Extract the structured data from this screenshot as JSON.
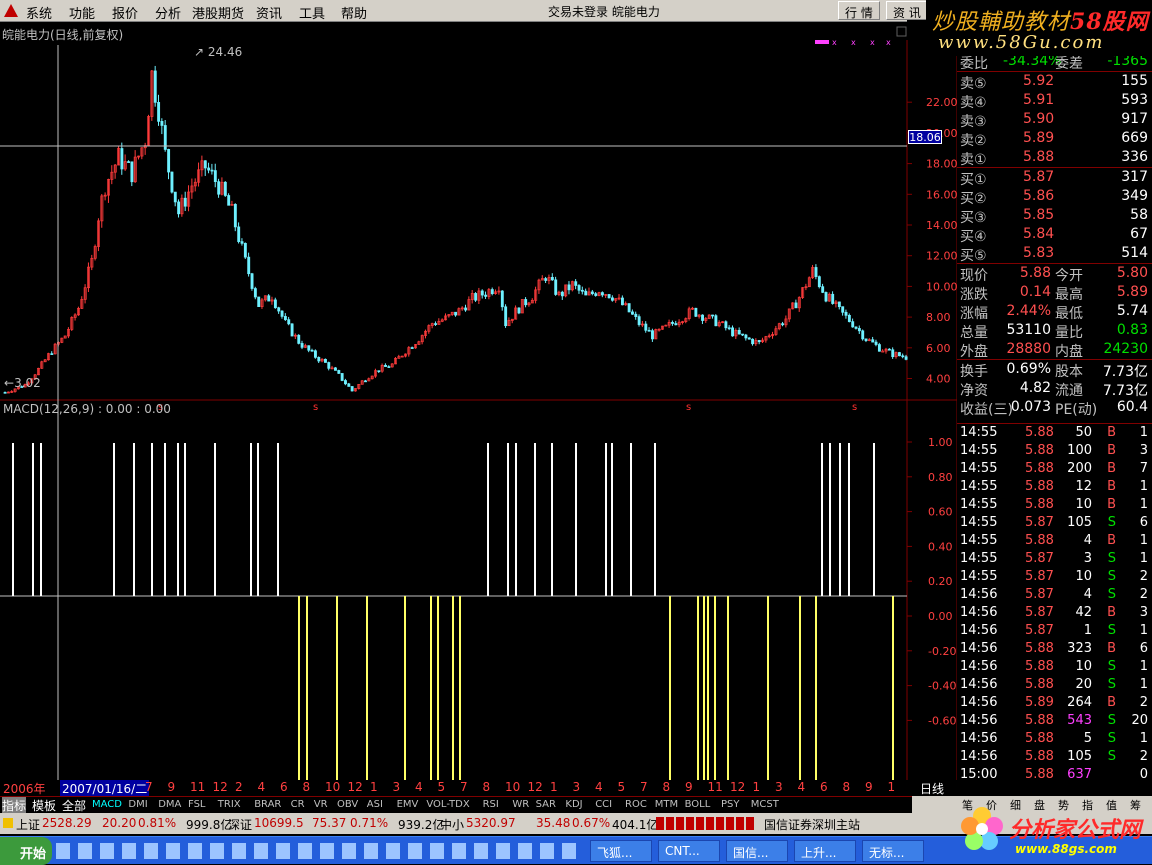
{
  "menu": {
    "items": [
      "系统",
      "功能",
      "报价",
      "分析",
      "港股期货",
      "资讯",
      "工具",
      "帮助"
    ],
    "center": "交易未登录  皖能电力",
    "tabs": [
      "行 情",
      "资 讯"
    ]
  },
  "watermark": {
    "line1a": "炒股輔助教材",
    "line1b": "58股网",
    "line2": "www.58Gu.com"
  },
  "chart": {
    "title": "皖能电力(日线,前复权)",
    "high_label": "24.46",
    "low_label": "3.02",
    "cursor_price": "18.06",
    "y_ticks": [
      "22.00",
      "20.00",
      "18.00",
      "16.00",
      "14.00",
      "12.00",
      "10.00",
      "8.00",
      "6.00",
      "4.00"
    ]
  },
  "macd": {
    "title": "MACD(12,26,9) : 0.00 : 0.00",
    "y_ticks": [
      "1.00",
      "0.80",
      "0.60",
      "0.40",
      "0.20",
      "0.00",
      "-0.20",
      "-0.40",
      "-0.60"
    ]
  },
  "colors": {
    "up": "#ff3b3b",
    "down": "#6ef0ff",
    "macd_pos": "#ffffff",
    "macd_neg": "#ffff66",
    "grid": "#800000",
    "axis_text": "#ff4040"
  },
  "chart_data": {
    "type": "candlestick",
    "ylim": [
      2.6,
      25.4
    ],
    "high": 24.46,
    "low": 3.02,
    "trend": [
      [
        0,
        3.1
      ],
      [
        6,
        3.6
      ],
      [
        10,
        4.6
      ],
      [
        14,
        5.8
      ],
      [
        18,
        6.8
      ],
      [
        22,
        8.6
      ],
      [
        26,
        11.6
      ],
      [
        28,
        14.6
      ],
      [
        30,
        16.6
      ],
      [
        34,
        18.4
      ],
      [
        38,
        17.4
      ],
      [
        42,
        19.6
      ],
      [
        44,
        23.8
      ],
      [
        46,
        21.6
      ],
      [
        48,
        18.6
      ],
      [
        52,
        14.8
      ],
      [
        56,
        16.6
      ],
      [
        60,
        17.8
      ],
      [
        64,
        16.6
      ],
      [
        68,
        14.8
      ],
      [
        72,
        11.6
      ],
      [
        76,
        8.8
      ],
      [
        80,
        9.4
      ],
      [
        84,
        7.6
      ],
      [
        88,
        6.4
      ],
      [
        92,
        5.6
      ],
      [
        96,
        5.0
      ],
      [
        100,
        4.2
      ],
      [
        104,
        3.2
      ],
      [
        108,
        4.0
      ],
      [
        112,
        4.6
      ],
      [
        116,
        4.9
      ],
      [
        120,
        5.8
      ],
      [
        124,
        6.6
      ],
      [
        128,
        7.6
      ],
      [
        132,
        7.9
      ],
      [
        136,
        8.4
      ],
      [
        140,
        9.2
      ],
      [
        144,
        9.6
      ],
      [
        148,
        10.1
      ],
      [
        150,
        7.6
      ],
      [
        154,
        8.6
      ],
      [
        158,
        9.4
      ],
      [
        162,
        10.7
      ],
      [
        166,
        9.4
      ],
      [
        170,
        10.1
      ],
      [
        174,
        9.3
      ],
      [
        178,
        9.8
      ],
      [
        182,
        9.4
      ],
      [
        186,
        8.6
      ],
      [
        190,
        7.6
      ],
      [
        194,
        6.8
      ],
      [
        198,
        7.3
      ],
      [
        202,
        7.9
      ],
      [
        206,
        8.4
      ],
      [
        210,
        8.0
      ],
      [
        214,
        7.6
      ],
      [
        218,
        7.0
      ],
      [
        222,
        6.6
      ],
      [
        226,
        6.3
      ],
      [
        230,
        7.1
      ],
      [
        234,
        7.9
      ],
      [
        238,
        9.3
      ],
      [
        242,
        11.0
      ],
      [
        246,
        9.4
      ],
      [
        250,
        8.4
      ],
      [
        254,
        7.6
      ],
      [
        258,
        6.6
      ],
      [
        262,
        6.0
      ],
      [
        266,
        5.6
      ],
      [
        270,
        5.4
      ]
    ]
  },
  "date_axis": {
    "year": "2006年",
    "cursor_date": "2007/01/16/二",
    "ticks": [
      "7",
      "9",
      "11",
      "12",
      "2",
      "4",
      "6",
      "8",
      "10",
      "12",
      "1",
      "3",
      "4",
      "5",
      "7",
      "8",
      "10",
      "12",
      "1",
      "3",
      "4",
      "5",
      "7",
      "8",
      "9",
      "11",
      "12",
      "1",
      "3",
      "4",
      "6",
      "8",
      "9",
      "1"
    ],
    "period": "日线"
  },
  "indicator_tabs": [
    "指标",
    "模板",
    "全部",
    "MACD",
    "DMI",
    "DMA",
    "FSL",
    "TRIX",
    "BRAR",
    "CR",
    "VR",
    "OBV",
    "ASI",
    "EMV",
    "VOL-TDX",
    "RSI",
    "WR",
    "SAR",
    "KDJ",
    "CCI",
    "ROC",
    "MTM",
    "BOLL",
    "PSY",
    "MCST"
  ],
  "right_tabs": [
    "笔",
    "价",
    "细",
    "盘",
    "势",
    "指",
    "值",
    "筹"
  ],
  "quote": {
    "ratio": {
      "label": "委比",
      "value": "-34.34%",
      "label2": "委差",
      "value2": "-1365"
    },
    "asks": [
      {
        "label": "卖⑤",
        "price": "5.92",
        "vol": "155"
      },
      {
        "label": "卖④",
        "price": "5.91",
        "vol": "593"
      },
      {
        "label": "卖③",
        "price": "5.90",
        "vol": "917"
      },
      {
        "label": "卖②",
        "price": "5.89",
        "vol": "669"
      },
      {
        "label": "卖①",
        "price": "5.88",
        "vol": "336"
      }
    ],
    "bids": [
      {
        "label": "买①",
        "price": "5.87",
        "vol": "317"
      },
      {
        "label": "买②",
        "price": "5.86",
        "vol": "349"
      },
      {
        "label": "买③",
        "price": "5.85",
        "vol": "58"
      },
      {
        "label": "买④",
        "price": "5.84",
        "vol": "67"
      },
      {
        "label": "买⑤",
        "price": "5.83",
        "vol": "514"
      }
    ],
    "stats": [
      [
        "现价",
        "5.88",
        "今开",
        "5.80"
      ],
      [
        "涨跌",
        "0.14",
        "最高",
        "5.89"
      ],
      [
        "涨幅",
        "2.44%",
        "最低",
        "5.74"
      ],
      [
        "总量",
        "53110",
        "量比",
        "0.83"
      ],
      [
        "外盘",
        "28880",
        "内盘",
        "24230"
      ],
      [
        "换手",
        "0.69%",
        "股本",
        "7.73亿"
      ],
      [
        "净资",
        "4.82",
        "流通",
        "7.73亿"
      ],
      [
        "收益(三)",
        "0.073",
        "PE(动)",
        "60.4"
      ]
    ]
  },
  "ticks": [
    [
      "14:55",
      "5.88",
      "50",
      "B",
      "1"
    ],
    [
      "14:55",
      "5.88",
      "100",
      "B",
      "3"
    ],
    [
      "14:55",
      "5.88",
      "200",
      "B",
      "7"
    ],
    [
      "14:55",
      "5.88",
      "12",
      "B",
      "1"
    ],
    [
      "14:55",
      "5.88",
      "10",
      "B",
      "1"
    ],
    [
      "14:55",
      "5.87",
      "105",
      "S",
      "6"
    ],
    [
      "14:55",
      "5.88",
      "4",
      "B",
      "1"
    ],
    [
      "14:55",
      "5.87",
      "3",
      "S",
      "1"
    ],
    [
      "14:55",
      "5.87",
      "10",
      "S",
      "2"
    ],
    [
      "14:56",
      "5.87",
      "4",
      "S",
      "2"
    ],
    [
      "14:56",
      "5.87",
      "42",
      "B",
      "3"
    ],
    [
      "14:56",
      "5.87",
      "1",
      "S",
      "1"
    ],
    [
      "14:56",
      "5.88",
      "323",
      "B",
      "6"
    ],
    [
      "14:56",
      "5.88",
      "10",
      "S",
      "1"
    ],
    [
      "14:56",
      "5.88",
      "20",
      "S",
      "1"
    ],
    [
      "14:56",
      "5.89",
      "264",
      "B",
      "2"
    ],
    [
      "14:56",
      "5.88",
      "543",
      "S",
      "20"
    ],
    [
      "14:56",
      "5.88",
      "5",
      "S",
      "1"
    ],
    [
      "14:56",
      "5.88",
      "105",
      "S",
      "2"
    ],
    [
      "15:00",
      "5.88",
      "637",
      "",
      "0"
    ]
  ],
  "statusbar": {
    "sh_label": "上证",
    "sh_val": "2528.29",
    "sh_chg": "20.20",
    "sh_pct": "0.81%",
    "sh_amt": "999.8亿",
    "sz_label": "深证",
    "sz_val": "10699.5",
    "sz_chg": "75.37",
    "sz_pct": "0.71%",
    "sz_amt": "939.2亿",
    "zx_label": "中小",
    "zx_val": "5320.97",
    "zx_chg": "35.48",
    "zx_pct": "0.67%",
    "zx_amt": "404.1亿",
    "server": "国信证券深圳主站"
  },
  "taskbar": {
    "start": "开始",
    "buttons": [
      "飞狐...",
      "CNT...",
      "国信...",
      "上升...",
      "无标..."
    ]
  },
  "logo": {
    "title": "分析家公式网",
    "url": "www.88gs.com"
  }
}
